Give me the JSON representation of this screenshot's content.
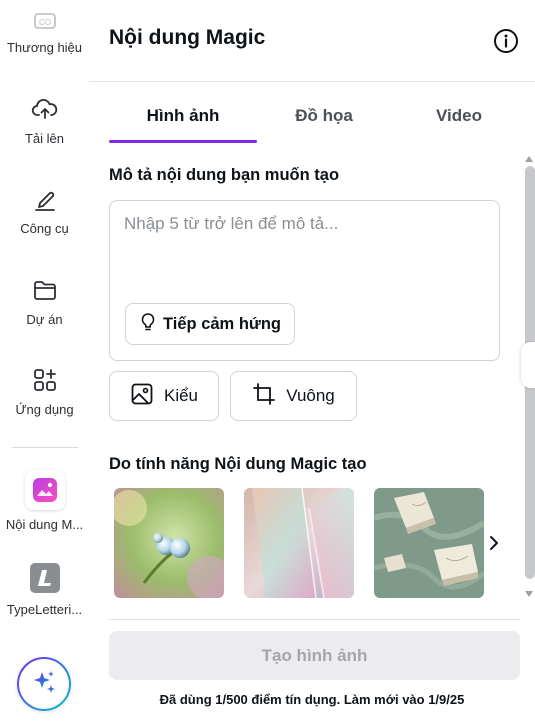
{
  "rail": {
    "items": [
      {
        "label": "Thương hiệu",
        "icon": "brand-icon"
      },
      {
        "label": "Tải lên",
        "icon": "cloud-upload-icon"
      },
      {
        "label": "Công cụ",
        "icon": "pen-tool-icon"
      },
      {
        "label": "Dự án",
        "icon": "folder-icon"
      },
      {
        "label": "Ứng dụng",
        "icon": "apps-grid-icon"
      },
      {
        "label": "Nội dung M...",
        "icon": "magic-media-app-icon"
      },
      {
        "label": "TypeLetteri...",
        "icon": "typelettering-app-icon"
      }
    ],
    "magic_button_icon": "sparkles-icon"
  },
  "panel": {
    "title": "Nội dung Magic",
    "tabs": [
      {
        "label": "Hình ảnh",
        "active": true
      },
      {
        "label": "Đồ họa",
        "active": false
      },
      {
        "label": "Video",
        "active": false
      }
    ],
    "prompt_label": "Mô tả nội dung bạn muốn tạo",
    "prompt_placeholder": "Nhập 5 từ trở lên để mô tả...",
    "prompt_value": "",
    "inspire_label": "Tiếp cảm hứng",
    "style_label": "Kiểu",
    "aspect_label": "Vuông",
    "gallery_label": "Do tính năng Nội dung Magic tạo",
    "gallery": [
      {
        "name": "dewdrop-flower",
        "icon": "image"
      },
      {
        "name": "pastel-glass-panels",
        "icon": "image"
      },
      {
        "name": "marble-shapes",
        "icon": "image"
      }
    ],
    "generate_label": "Tạo hình ảnh",
    "credits_text": "Đã dùng 1/500 điểm tín dụng. Làm mới vào 1/9/25"
  },
  "colors": {
    "accent": "#7d2ae8",
    "disabled_bg": "#ececee",
    "disabled_text": "#a3a7ab"
  }
}
